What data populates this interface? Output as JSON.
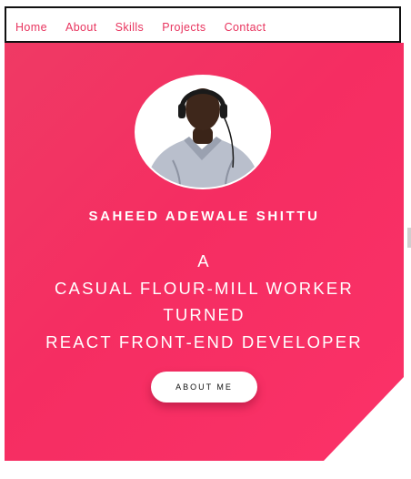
{
  "nav": {
    "items": [
      {
        "label": "Home"
      },
      {
        "label": "About"
      },
      {
        "label": "Skills"
      },
      {
        "label": "Projects"
      },
      {
        "label": "Contact"
      }
    ]
  },
  "hero": {
    "name": "SAHEED ADEWALE SHITTU",
    "tagline_lines": [
      "A",
      "CASUAL FLOUR-MILL WORKER",
      "TURNED",
      "REACT FRONT-END DEVELOPER"
    ],
    "about_button_label": "ABOUT ME"
  },
  "colors": {
    "accent": "#f52d62",
    "nav_text": "#e8355f",
    "text_on_accent": "#ffffff"
  },
  "icons": {
    "avatar": "profile-photo"
  }
}
